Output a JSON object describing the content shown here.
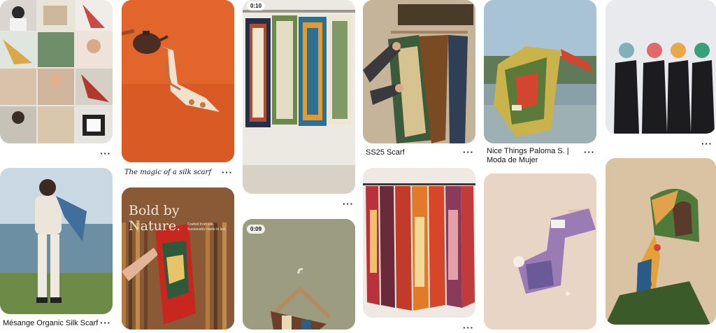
{
  "pins": {
    "collage": {
      "title": "",
      "more": "···"
    },
    "orange_teapot": {
      "title": "The magic of a silk scarf",
      "more": "···"
    },
    "hanging_rack": {
      "video_time": "0:10",
      "more": "···"
    },
    "ss25": {
      "title": "SS25 Scarf",
      "more": "···"
    },
    "paloma": {
      "title": "Nice Things Paloma S. | Moda de Mujer",
      "more": "···"
    },
    "four_women": {
      "more": "···"
    },
    "mesange": {
      "title": "Mésange Organic Silk Scarf",
      "more": "···"
    },
    "bold_nature": {
      "headline": "Bold by Nature.",
      "subtext": "Crafted from silk. Sustainably made to last.",
      "more": "···"
    },
    "hanger": {
      "video_time": "0:09"
    },
    "red_scarves": {
      "more": "···"
    },
    "purple_scarf": {},
    "headscarf_woman": {}
  },
  "colors": {
    "orange_bg": "#e2652c",
    "olive_bg": "#8a8f6e",
    "sky_bg": "#a9c3d6"
  }
}
